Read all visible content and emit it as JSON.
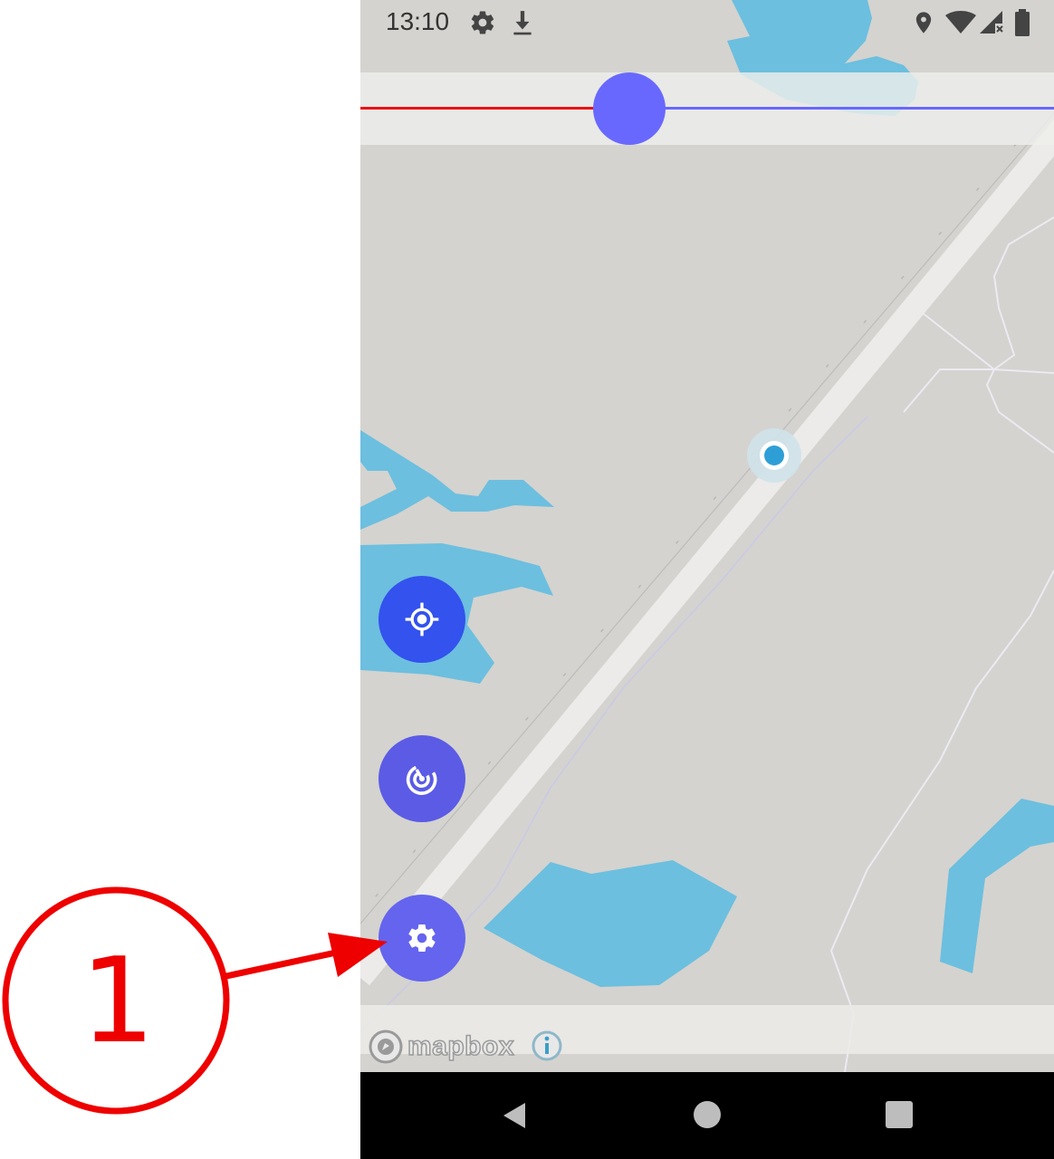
{
  "status_bar": {
    "time": "13:10",
    "left_icons": [
      "settings-gear-icon",
      "download-icon"
    ],
    "right_icons": [
      "location-pin-icon",
      "wifi-icon",
      "cell-signal-no-data-icon",
      "battery-icon"
    ]
  },
  "slider": {
    "position_fraction": 0.39,
    "filled_color": "#ee1111",
    "track_color": "#6868ff",
    "thumb_color": "#6868ff"
  },
  "map": {
    "attribution_logo": "mapbox",
    "attribution_info_icon": "info-icon",
    "water_color": "#6cbfdf",
    "land_color": "#d4d3cf",
    "road_color": "#ecebe9",
    "user_location_color": "#2e9fd6"
  },
  "fabs": [
    {
      "name": "locate",
      "icon": "gps-crosshair-icon",
      "color": "#3352ee"
    },
    {
      "name": "radar",
      "icon": "radar-icon",
      "color": "#5b5be6"
    },
    {
      "name": "settings",
      "icon": "gear-icon",
      "color": "#6464ee"
    }
  ],
  "nav_bar": {
    "buttons": [
      "back-triangle-icon",
      "home-circle-icon",
      "recents-square-icon"
    ]
  },
  "annotation": {
    "number": "1",
    "color": "#ee0000",
    "target": "settings"
  }
}
